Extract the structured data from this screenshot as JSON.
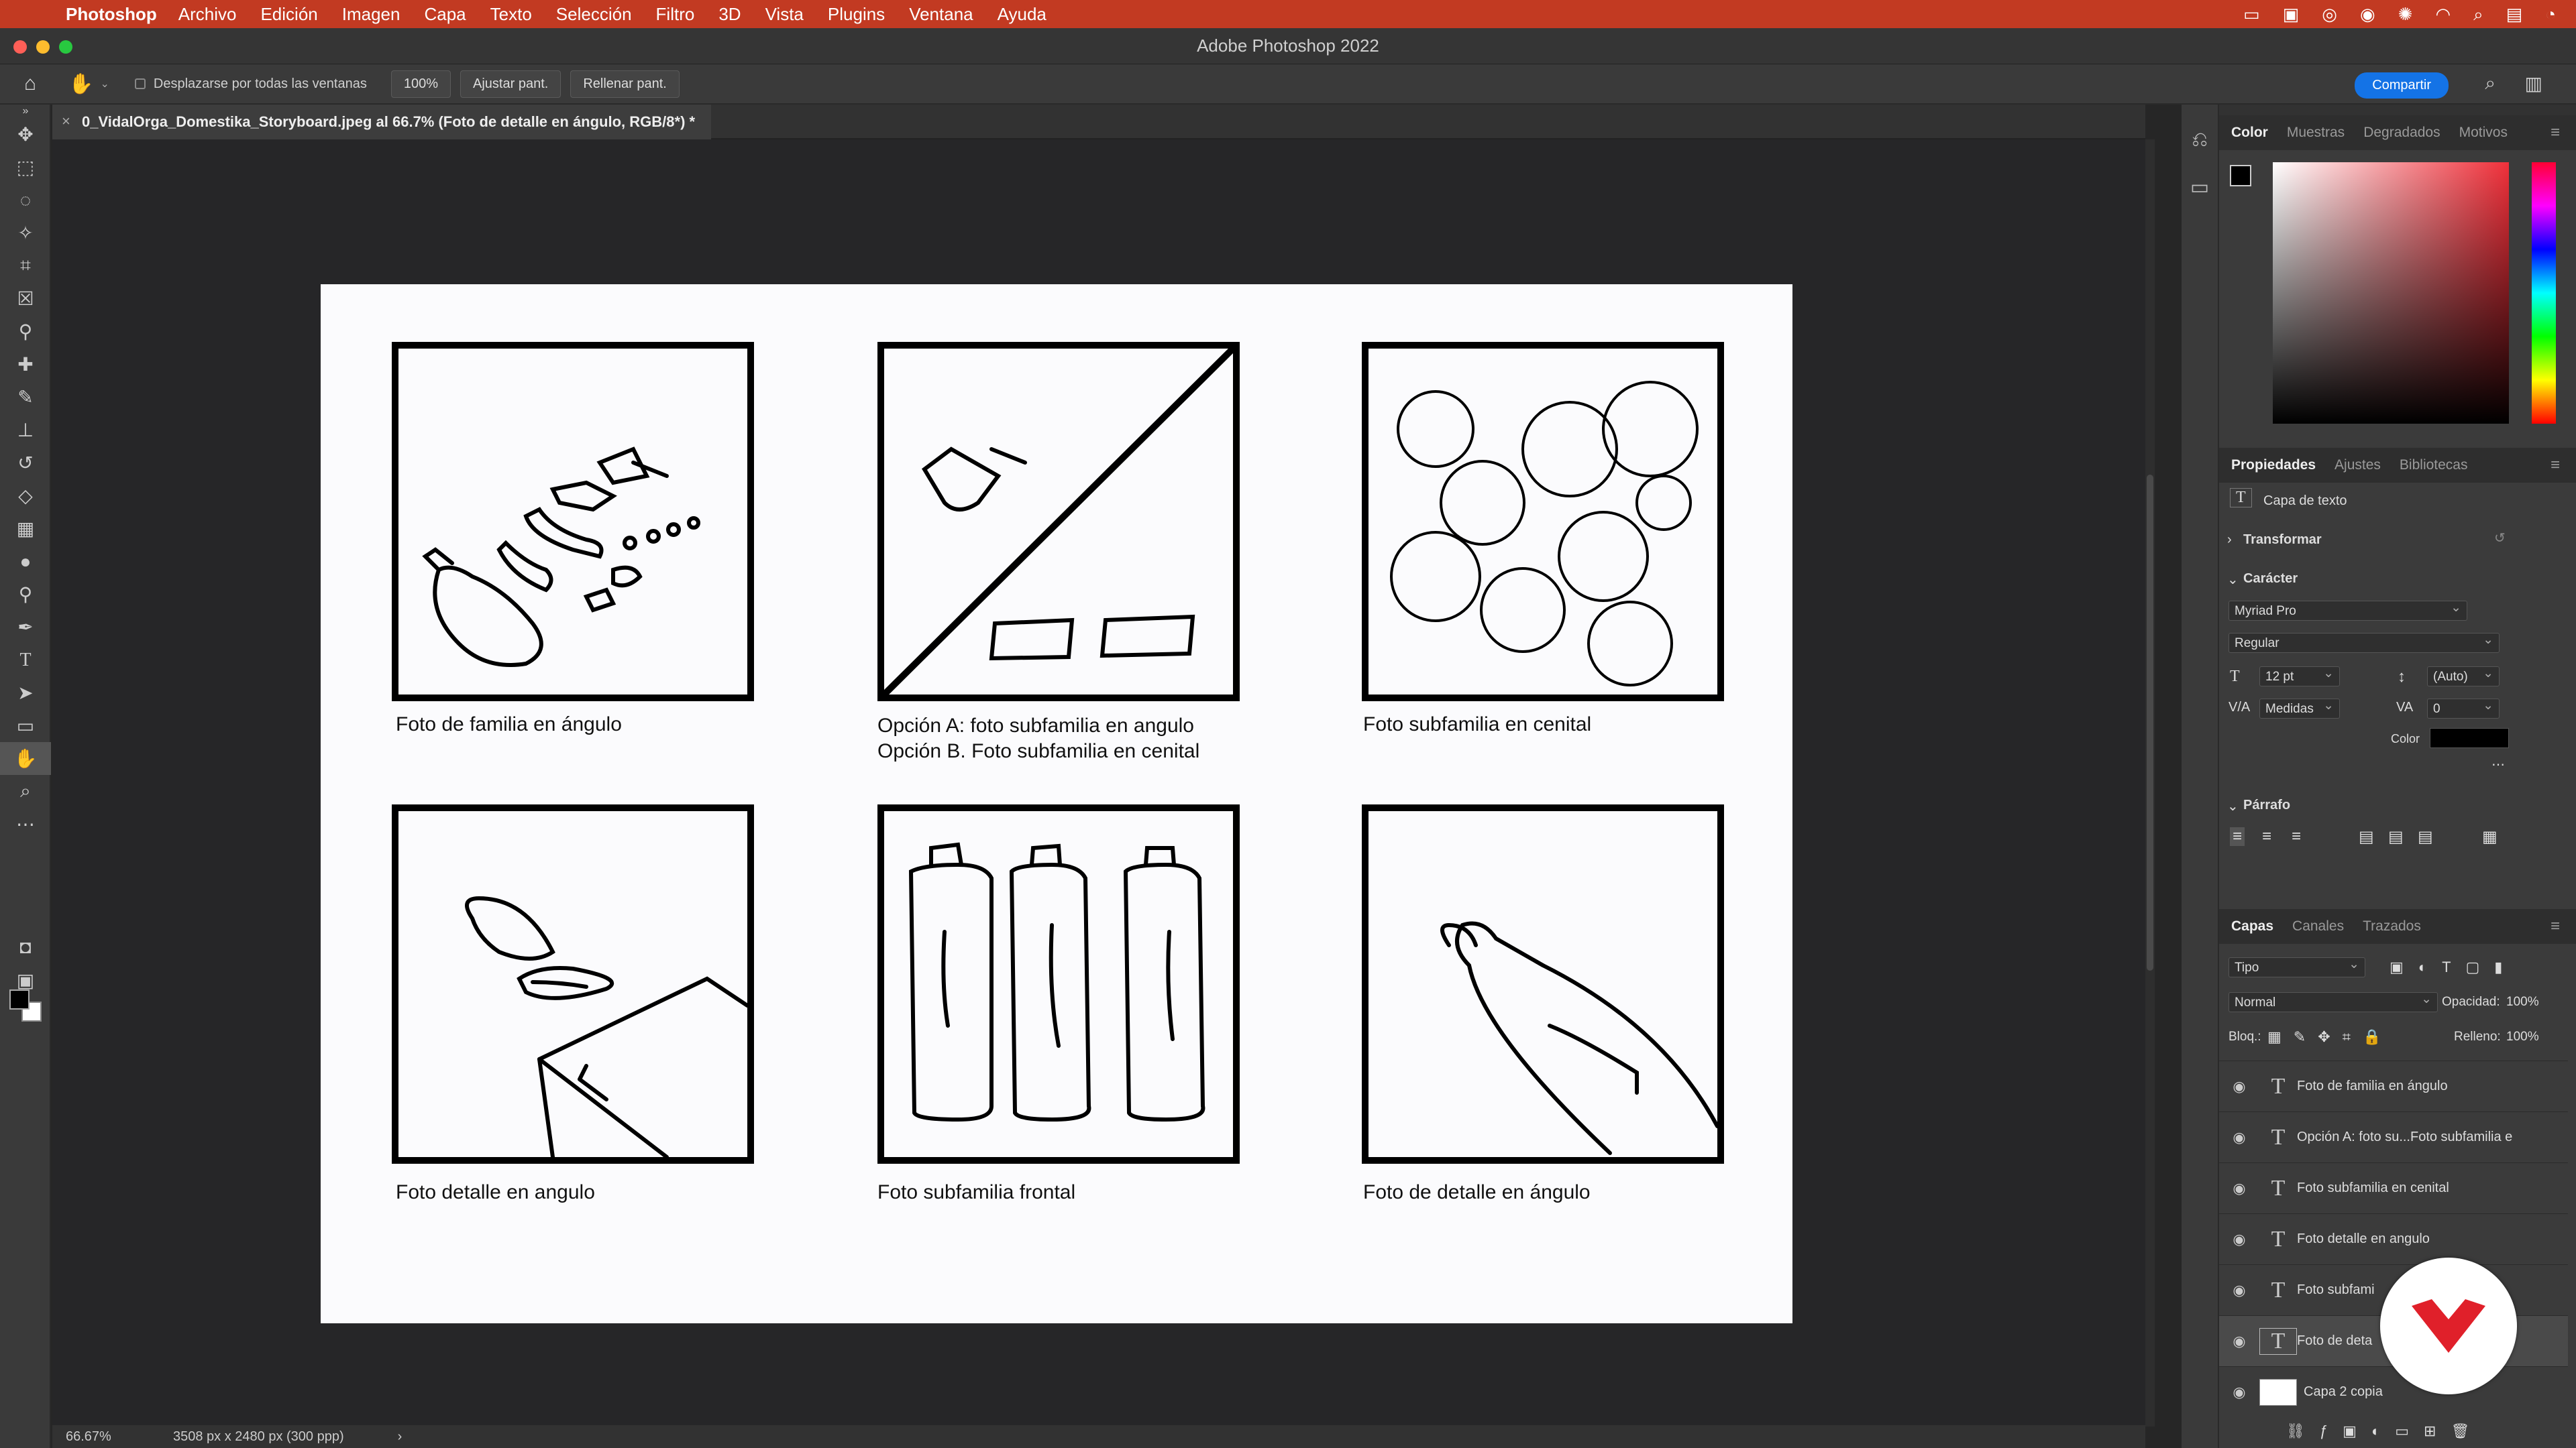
{
  "menubar": {
    "app": "Photoshop",
    "items": [
      "Archivo",
      "Edición",
      "Imagen",
      "Capa",
      "Texto",
      "Selección",
      "Filtro",
      "3D",
      "Vista",
      "Plugins",
      "Ventana",
      "Ayuda"
    ]
  },
  "window": {
    "title": "Adobe Photoshop 2022"
  },
  "options": {
    "scroll_all_label": "Desplazarse por todas las ventanas",
    "zoom_value": "100%",
    "fit_label": "Ajustar pant.",
    "fill_label": "Rellenar pant.",
    "share_label": "Compartir"
  },
  "document": {
    "tab_title": "0_VidalOrga_Domestika_Storyboard.jpeg al 66.7% (Foto de detalle en ángulo, RGB/8*) *",
    "captions": {
      "c1": "Foto de familia en ángulo",
      "c2": "Opción A: foto subfamilia en angulo\nOpción B. Foto subfamilia en cenital",
      "c3": "Foto subfamilia en cenital",
      "c4": "Foto detalle en angulo",
      "c5": "Foto subfamilia frontal",
      "c6": "Foto de detalle en ángulo"
    }
  },
  "status": {
    "zoom": "66.67%",
    "doc_size": "3508 px x 2480 px (300 ppp)"
  },
  "panels": {
    "color_tabs": [
      "Color",
      "Muestras",
      "Degradados",
      "Motivos"
    ],
    "prop_tabs": [
      "Propiedades",
      "Ajustes",
      "Bibliotecas"
    ],
    "prop": {
      "layer_kind": "Capa de texto",
      "transform": "Transformar",
      "character": "Carácter",
      "font": "Myriad Pro",
      "style": "Regular",
      "size": "12 pt",
      "leading": "(Auto)",
      "kerning": "Medidas",
      "tracking": "0",
      "color_label": "Color",
      "paragraph": "Párrafo"
    },
    "layer_tabs": [
      "Capas",
      "Canales",
      "Trazados"
    ],
    "layers_ctrl": {
      "kind": "Tipo",
      "blend": "Normal",
      "opacity_label": "Opacidad:",
      "opacity": "100%",
      "lock_label": "Bloq.:",
      "fill_label": "Relleno:",
      "fill": "100%"
    },
    "layers": [
      {
        "name": "Foto de familia en ángulo"
      },
      {
        "name": "Opción A: foto su...Foto subfamilia e"
      },
      {
        "name": "Foto subfamilia en cenital"
      },
      {
        "name": "Foto detalle en angulo"
      },
      {
        "name": "Foto subfami"
      },
      {
        "name": "Foto de deta"
      },
      {
        "name": "Capa 2 copia"
      }
    ]
  },
  "colors": {
    "accent": "#1473e6",
    "menubar": "#c23a22",
    "logo": "#e0202a"
  }
}
